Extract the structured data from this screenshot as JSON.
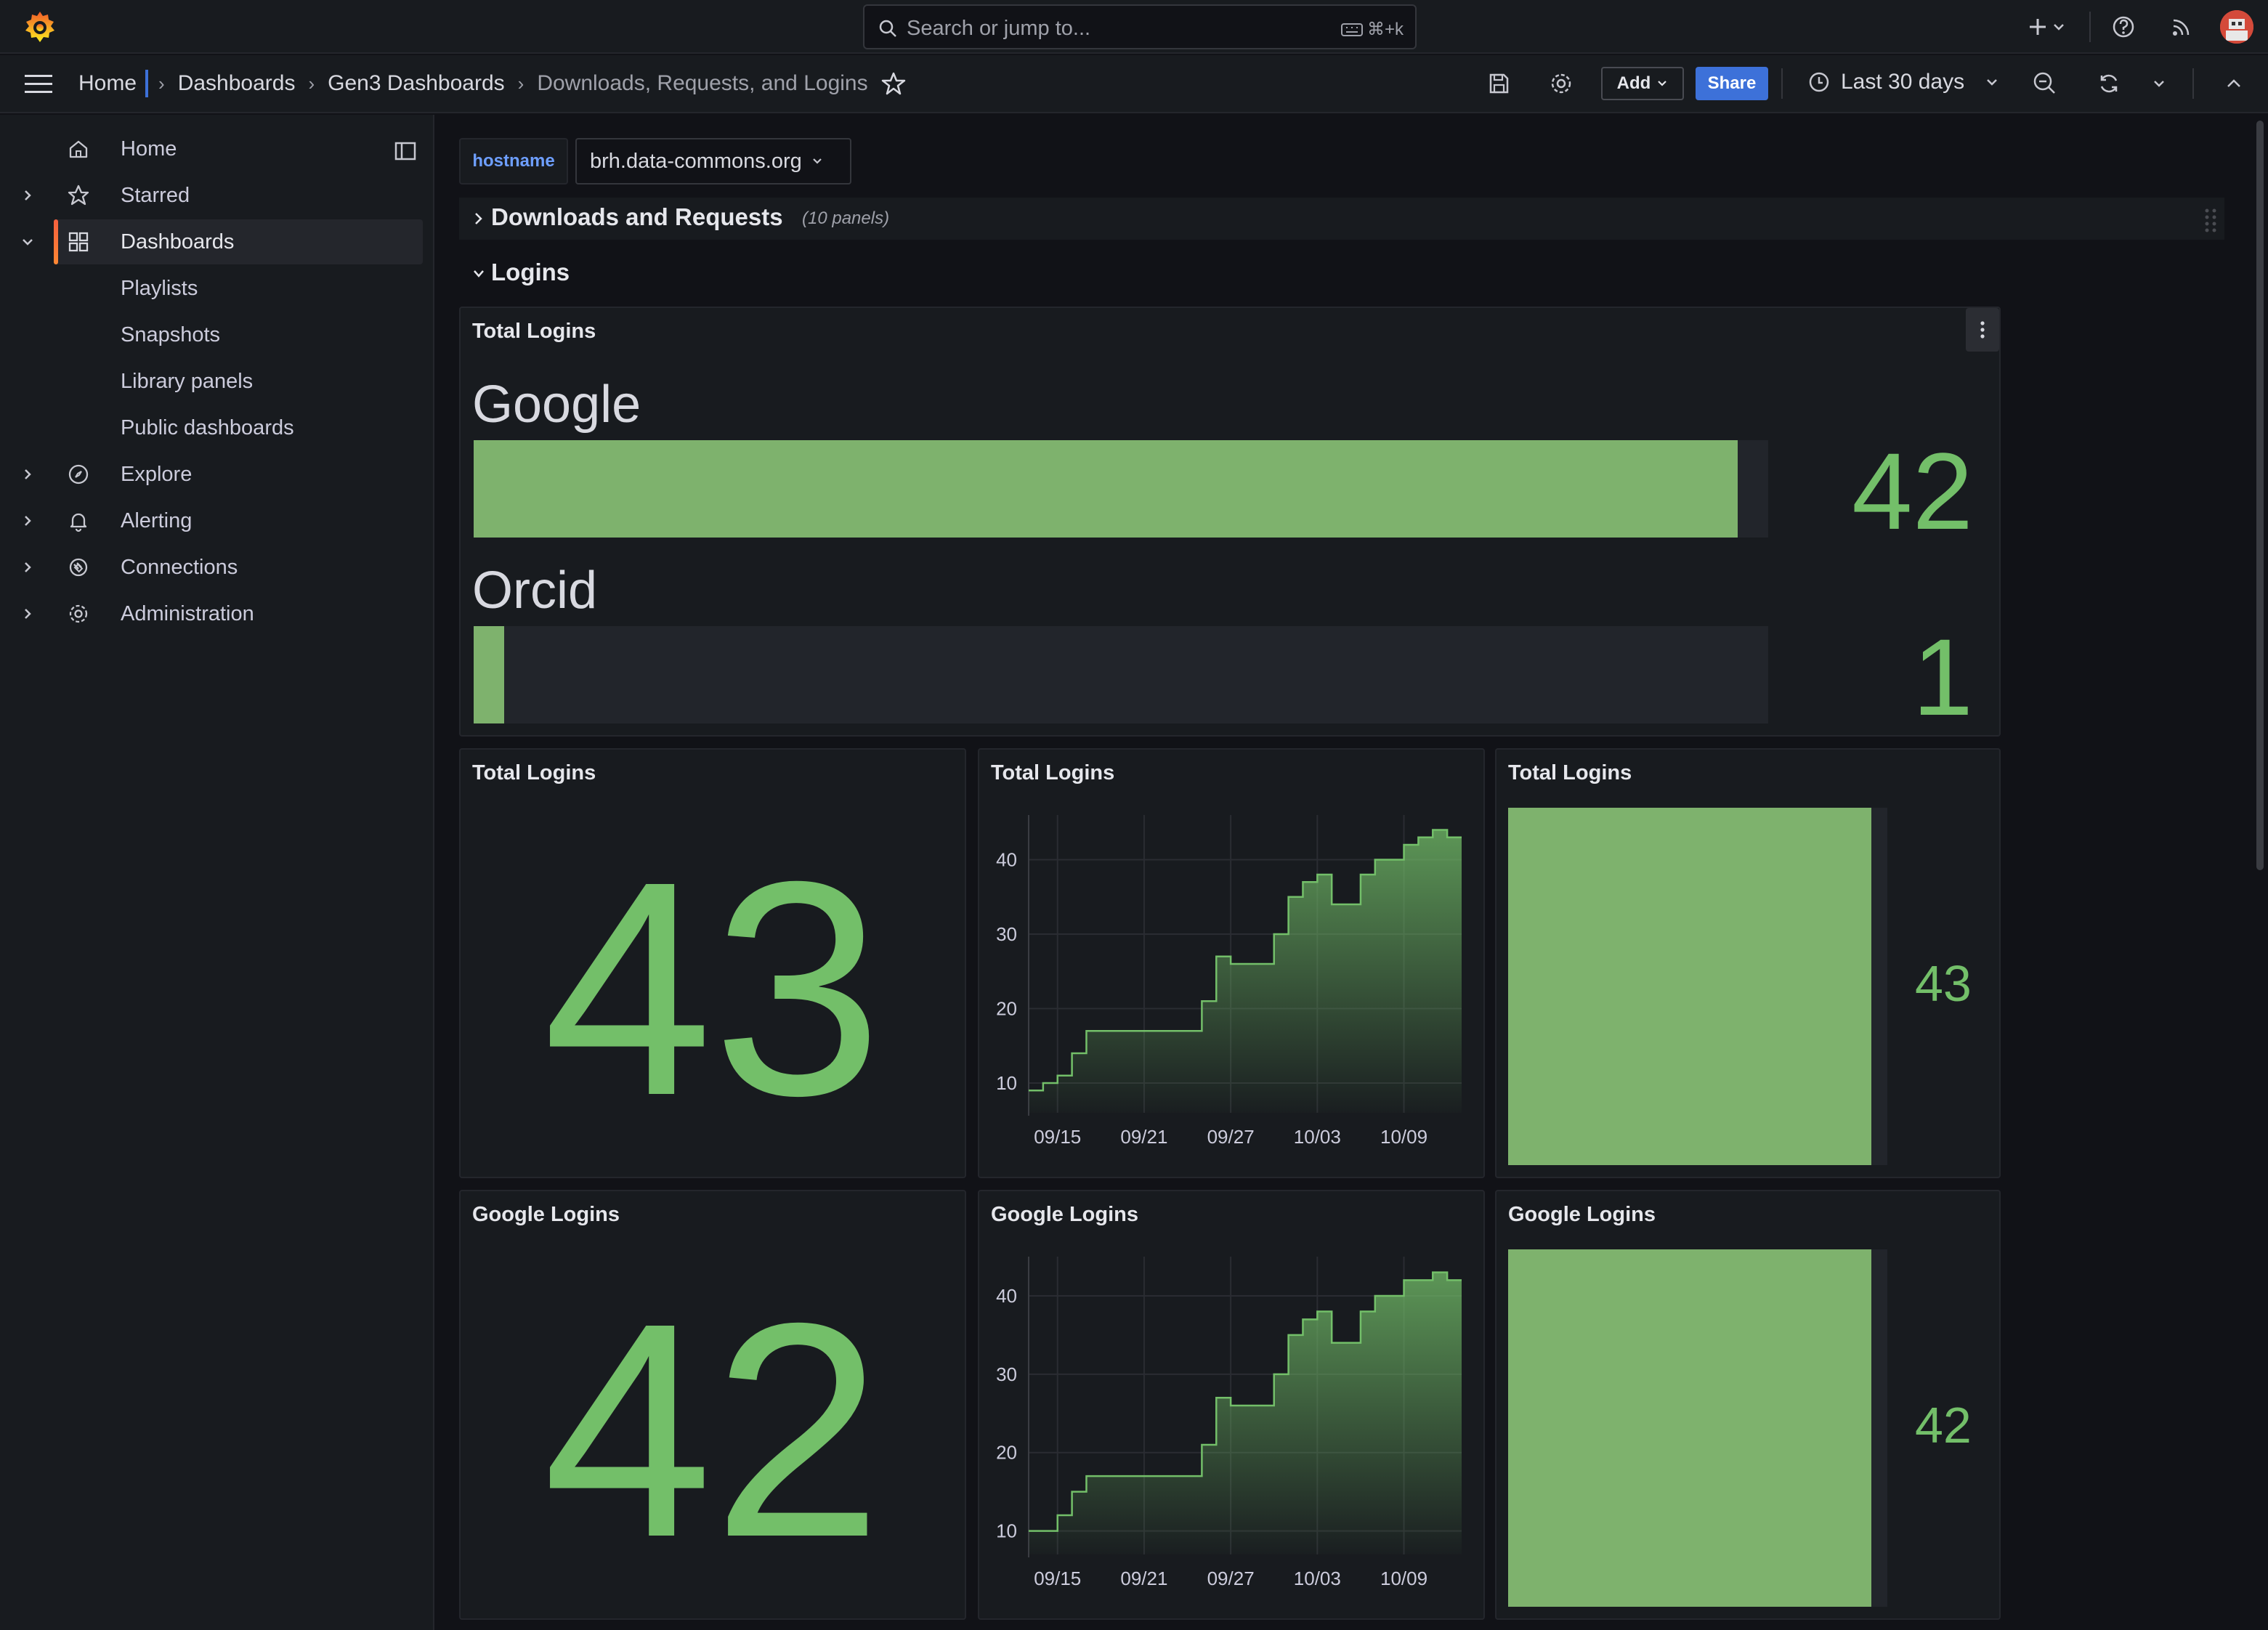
{
  "topbar": {
    "search_placeholder": "Search or jump to...",
    "search_shortcut": "⌘+k"
  },
  "breadcrumb": {
    "home": "Home",
    "dashboards": "Dashboards",
    "folder": "Gen3 Dashboards",
    "current": "Downloads, Requests, and Logins"
  },
  "toolbar": {
    "add_label": "Add",
    "share_label": "Share",
    "time_range": "Last 30 days"
  },
  "sidebar": {
    "items": [
      {
        "label": "Home",
        "icon": "home-icon"
      },
      {
        "label": "Starred",
        "icon": "star-icon"
      },
      {
        "label": "Dashboards",
        "icon": "grid-icon"
      },
      {
        "label": "Playlists"
      },
      {
        "label": "Snapshots"
      },
      {
        "label": "Library panels"
      },
      {
        "label": "Public dashboards"
      },
      {
        "label": "Explore",
        "icon": "compass-icon"
      },
      {
        "label": "Alerting",
        "icon": "bell-icon"
      },
      {
        "label": "Connections",
        "icon": "connections-icon"
      },
      {
        "label": "Administration",
        "icon": "gear-icon"
      }
    ]
  },
  "variables": {
    "hostname_label": "hostname",
    "hostname_value": "brh.data-commons.org"
  },
  "rows": {
    "collapsed_title": "Downloads and Requests",
    "collapsed_count": "(10 panels)",
    "expanded_title": "Logins"
  },
  "colors": {
    "accent_green": "#73bf69",
    "bar_green": "#7eb26d",
    "primary_blue": "#3d71d9",
    "active_orange": "#f55f3e"
  },
  "panels": {
    "bargauge": {
      "title": "Total Logins",
      "items": [
        {
          "name": "Google",
          "value": "42",
          "fraction": 0.9767
        },
        {
          "name": "Orcid",
          "value": "1",
          "fraction": 0.0233
        }
      ]
    },
    "stat_total": {
      "title": "Total Logins",
      "value": "43"
    },
    "ts_total": {
      "title": "Total Logins"
    },
    "bar_total": {
      "title": "Total Logins",
      "value": "43"
    },
    "stat_google": {
      "title": "Google Logins",
      "value": "42"
    },
    "ts_google": {
      "title": "Google Logins"
    },
    "bar_google": {
      "title": "Google Logins",
      "value": "42"
    }
  },
  "chart_data": [
    {
      "type": "area",
      "title": "Total Logins",
      "x": [
        "09/13",
        "09/14",
        "09/15",
        "09/16",
        "09/17",
        "09/18",
        "09/19",
        "09/20",
        "09/21",
        "09/22",
        "09/23",
        "09/24",
        "09/25",
        "09/26",
        "09/27",
        "09/28",
        "09/29",
        "09/30",
        "10/01",
        "10/02",
        "10/03",
        "10/04",
        "10/05",
        "10/06",
        "10/07",
        "10/08",
        "10/09",
        "10/10",
        "10/11",
        "10/12",
        "10/13"
      ],
      "x_ticks": [
        "09/15",
        "09/21",
        "09/27",
        "10/03",
        "10/09"
      ],
      "y_ticks": [
        10,
        20,
        30,
        40
      ],
      "series": [
        {
          "values": [
            9,
            10,
            11,
            14,
            17,
            17,
            17,
            17,
            17,
            17,
            17,
            17,
            21,
            27,
            26,
            26,
            26,
            30,
            35,
            37,
            38,
            34,
            34,
            38,
            40,
            40,
            42,
            43,
            44,
            43,
            43
          ]
        }
      ],
      "ylim": [
        6,
        46
      ]
    },
    {
      "type": "area",
      "title": "Google Logins",
      "x": [
        "09/13",
        "09/14",
        "09/15",
        "09/16",
        "09/17",
        "09/18",
        "09/19",
        "09/20",
        "09/21",
        "09/22",
        "09/23",
        "09/24",
        "09/25",
        "09/26",
        "09/27",
        "09/28",
        "09/29",
        "09/30",
        "10/01",
        "10/02",
        "10/03",
        "10/04",
        "10/05",
        "10/06",
        "10/07",
        "10/08",
        "10/09",
        "10/10",
        "10/11",
        "10/12",
        "10/13"
      ],
      "x_ticks": [
        "09/15",
        "09/21",
        "09/27",
        "10/03",
        "10/09"
      ],
      "y_ticks": [
        10,
        20,
        30,
        40
      ],
      "series": [
        {
          "values": [
            10,
            10,
            12,
            15,
            17,
            17,
            17,
            17,
            17,
            17,
            17,
            17,
            21,
            27,
            26,
            26,
            26,
            30,
            35,
            37,
            38,
            34,
            34,
            38,
            40,
            40,
            42,
            42,
            43,
            42,
            42
          ]
        }
      ],
      "ylim": [
        7,
        45
      ]
    }
  ]
}
